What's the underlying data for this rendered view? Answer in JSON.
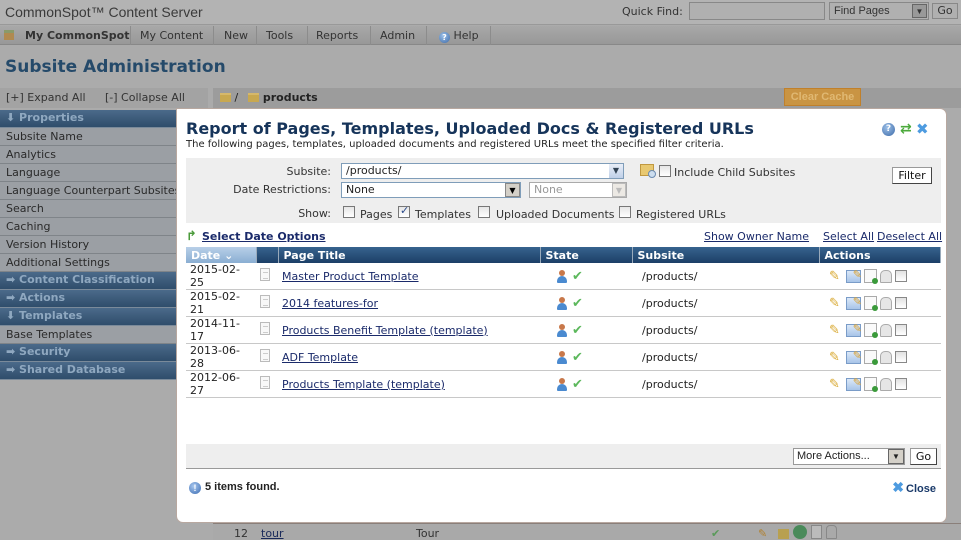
{
  "app": {
    "brand": "CommonSpot™ Content Server",
    "quick_find_label": "Quick Find:",
    "quick_find_value": "",
    "quick_find_type": "Find Pages",
    "go_label": "Go"
  },
  "menu": {
    "items": [
      "My CommonSpot",
      "My Content",
      "New",
      "Tools",
      "Reports",
      "Admin",
      "Help"
    ]
  },
  "page": {
    "title": "Subsite Administration",
    "expand_all": "[+] Expand All",
    "collapse_all": "[-] Collapse All",
    "breadcrumb_root": "/",
    "breadcrumb_current": "products",
    "clear_cache": "Clear Cache"
  },
  "sidebar": {
    "sections": [
      {
        "label": "Properties",
        "expanded": true,
        "items": [
          "Subsite Name",
          "Analytics",
          "Language",
          "Language Counterpart Subsites",
          "Search",
          "Caching",
          "Version History",
          "Additional Settings"
        ]
      },
      {
        "label": "Content Classification",
        "expanded": false,
        "items": []
      },
      {
        "label": "Actions",
        "expanded": false,
        "items": []
      },
      {
        "label": "Templates",
        "expanded": true,
        "items": [
          "Base Templates"
        ]
      },
      {
        "label": "Security",
        "expanded": false,
        "items": []
      },
      {
        "label": "Shared Database",
        "expanded": false,
        "items": []
      }
    ]
  },
  "background_row": {
    "number": "12",
    "name": "tour",
    "title": "Tour"
  },
  "modal": {
    "title": "Report of Pages, Templates, Uploaded Docs & Registered URLs",
    "subtitle": "The following pages, templates, uploaded documents and registered URLs meet the specified filter criteria.",
    "filter": {
      "subsite_label": "Subsite:",
      "subsite_value": "/products/",
      "include_child_label": "Include Child Subsites",
      "include_child_checked": false,
      "date_label": "Date Restrictions:",
      "date_value": "None",
      "date_value2": "None",
      "show_label": "Show:",
      "show_options": [
        {
          "label": "Pages",
          "checked": false
        },
        {
          "label": "Templates",
          "checked": true
        },
        {
          "label": "Uploaded Documents",
          "checked": false
        },
        {
          "label": "Registered URLs",
          "checked": false
        }
      ],
      "filter_button": "Filter"
    },
    "select_date_options": "Select Date Options",
    "show_owner_name": "Show Owner Name",
    "select_all": "Select All",
    "deselect_all": "Deselect All",
    "columns": [
      "Date",
      "",
      "Page Title",
      "State",
      "Subsite",
      "Actions"
    ],
    "date_sort_indicator": "⌄",
    "rows": [
      {
        "date": "2015-02-25",
        "title": "Master Product Template",
        "subsite": "/products/"
      },
      {
        "date": "2015-02-21",
        "title": "2014 features-for",
        "subsite": "/products/"
      },
      {
        "date": "2014-11-17",
        "title": "Products Benefit Template (template)",
        "subsite": "/products/"
      },
      {
        "date": "2013-06-28",
        "title": "ADF Template",
        "subsite": "/products/"
      },
      {
        "date": "2012-06-27",
        "title": "Products Template (template)",
        "subsite": "/products/"
      }
    ],
    "more_actions": "More Actions...",
    "go_label": "Go",
    "status": "5 items found.",
    "close_label": "Close"
  }
}
